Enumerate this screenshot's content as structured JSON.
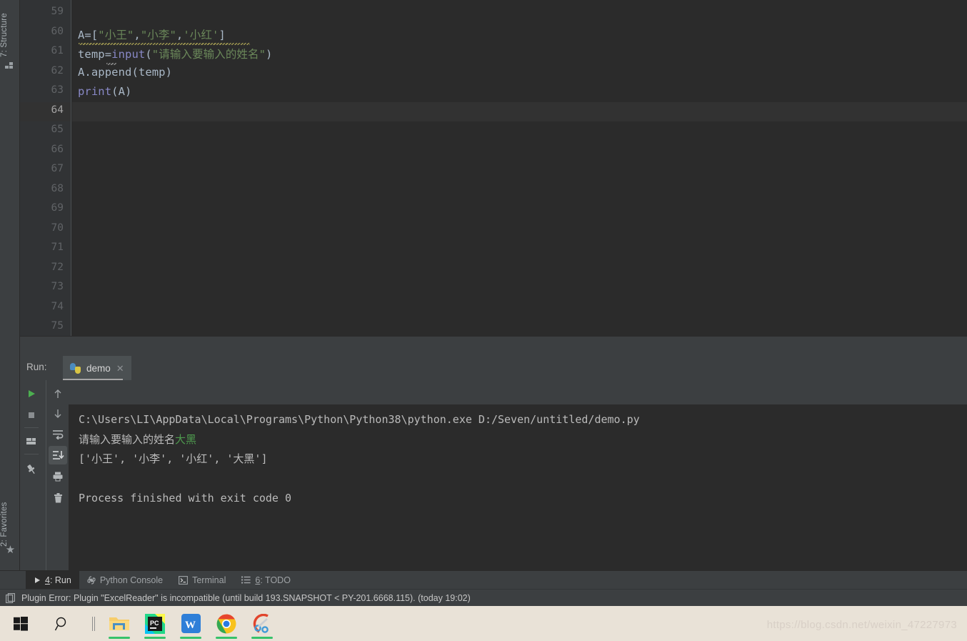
{
  "left_strip": {
    "structure_tab": "7: Structure",
    "favorites_tab": "2: Favorites",
    "structure_icon": "structure-icon",
    "favorites_icon": "star-icon"
  },
  "editor": {
    "first_line_number": 59,
    "current_line": 64,
    "line_numbers": [
      59,
      60,
      61,
      62,
      63,
      64,
      65,
      66,
      67,
      68,
      69,
      70,
      71,
      72,
      73,
      74,
      75
    ],
    "lines": [
      {
        "number": 60,
        "segments": [
          {
            "text": "A=[",
            "type": "plain"
          },
          {
            "text": "\"小王\"",
            "type": "string"
          },
          {
            "text": ",",
            "type": "plain"
          },
          {
            "text": "\"小李\"",
            "type": "string"
          },
          {
            "text": ",",
            "type": "plain"
          },
          {
            "text": "'小红'",
            "type": "string"
          },
          {
            "text": "]",
            "type": "plain"
          }
        ]
      },
      {
        "number": 61,
        "segments": [
          {
            "text": "temp=",
            "type": "plain"
          },
          {
            "text": "input",
            "type": "function"
          },
          {
            "text": "(",
            "type": "plain"
          },
          {
            "text": "\"请输入要输入的姓名\"",
            "type": "string"
          },
          {
            "text": ")",
            "type": "plain"
          }
        ]
      },
      {
        "number": 62,
        "segments": [
          {
            "text": "A.append(temp)",
            "type": "plain"
          }
        ]
      },
      {
        "number": 63,
        "segments": [
          {
            "text": "print",
            "type": "function"
          },
          {
            "text": "(A)",
            "type": "plain"
          }
        ]
      }
    ]
  },
  "run_panel": {
    "label": "Run:",
    "tab_name": "demo",
    "tab_icon": "python-icon",
    "close_icon": "close-icon",
    "toolbar_left": [
      {
        "name": "rerun-button",
        "icon": "play-icon"
      },
      {
        "name": "stop-button",
        "icon": "stop-icon"
      },
      {
        "name": "restore-layout-button",
        "icon": "layout-icon"
      },
      {
        "name": "pin-tab-button",
        "icon": "pin-icon"
      }
    ],
    "toolbar_right": [
      {
        "name": "up-the-stack-button",
        "icon": "arrow-up-icon",
        "selected": false
      },
      {
        "name": "down-the-stack-button",
        "icon": "arrow-down-icon",
        "selected": false
      },
      {
        "name": "soft-wrap-button",
        "icon": "soft-wrap-icon",
        "selected": false
      },
      {
        "name": "scroll-to-end-button",
        "icon": "scroll-to-end-icon",
        "selected": true
      },
      {
        "name": "print-button",
        "icon": "printer-icon",
        "selected": false
      },
      {
        "name": "clear-all-button",
        "icon": "trash-icon",
        "selected": false
      }
    ],
    "console": {
      "command_line": "C:\\Users\\LI\\AppData\\Local\\Programs\\Python\\Python38\\python.exe D:/Seven/untitled/demo.py",
      "prompt_text": "请输入要输入的姓名",
      "user_input": "大黑",
      "list_output": "['小王', '小李', '小红', '大黑']",
      "blank_line": "",
      "exit_line": "Process finished with exit code 0"
    }
  },
  "tool_windows": [
    {
      "label_prefix": "4",
      "label": ": Run",
      "icon": "play-icon",
      "active": true,
      "name": "tool-window-run"
    },
    {
      "label_prefix": "",
      "label": "Python Console",
      "icon": "python-icon",
      "active": false,
      "name": "tool-window-python-console"
    },
    {
      "label_prefix": "",
      "label": "Terminal",
      "icon": "terminal-icon",
      "active": false,
      "name": "tool-window-terminal"
    },
    {
      "label_prefix": "6",
      "label": ": TODO",
      "icon": "todo-icon",
      "active": false,
      "name": "tool-window-todo"
    }
  ],
  "status_bar": {
    "icon": "event-log-icon",
    "message": "Plugin Error: Plugin \"ExcelReader\" is incompatible (until build 193.SNAPSHOT < PY-201.6668.115). (today 19:02)"
  },
  "taskbar": {
    "items": [
      {
        "name": "start-button",
        "icon": "windows-logo-icon",
        "running": false
      },
      {
        "name": "search-button",
        "icon": "search-icon",
        "running": false
      },
      {
        "name": "task-view-button",
        "icon": "task-view-icon",
        "running": false
      },
      {
        "name": "file-explorer-button",
        "icon": "folder-icon",
        "running": true
      },
      {
        "name": "pycharm-button",
        "icon": "pycharm-icon",
        "running": true
      },
      {
        "name": "wps-button",
        "icon": "wps-icon",
        "running": true
      },
      {
        "name": "chrome-button",
        "icon": "chrome-icon",
        "running": true
      },
      {
        "name": "snipaste-button",
        "icon": "snipaste-icon",
        "running": true
      }
    ]
  },
  "watermark": "https://blog.csdn.net/weixin_47227973",
  "colors": {
    "editor_bg": "#2b2b2b",
    "panel_bg": "#3c3f41",
    "gutter_bg": "#313335",
    "string": "#6a8759",
    "function": "#8888c6",
    "plain_text": "#a9b7c6",
    "console_text": "#bbbbbb",
    "user_input": "#4e9a4e",
    "taskbar_bg": "#e9e2d7",
    "running_indicator": "#37c26a"
  }
}
